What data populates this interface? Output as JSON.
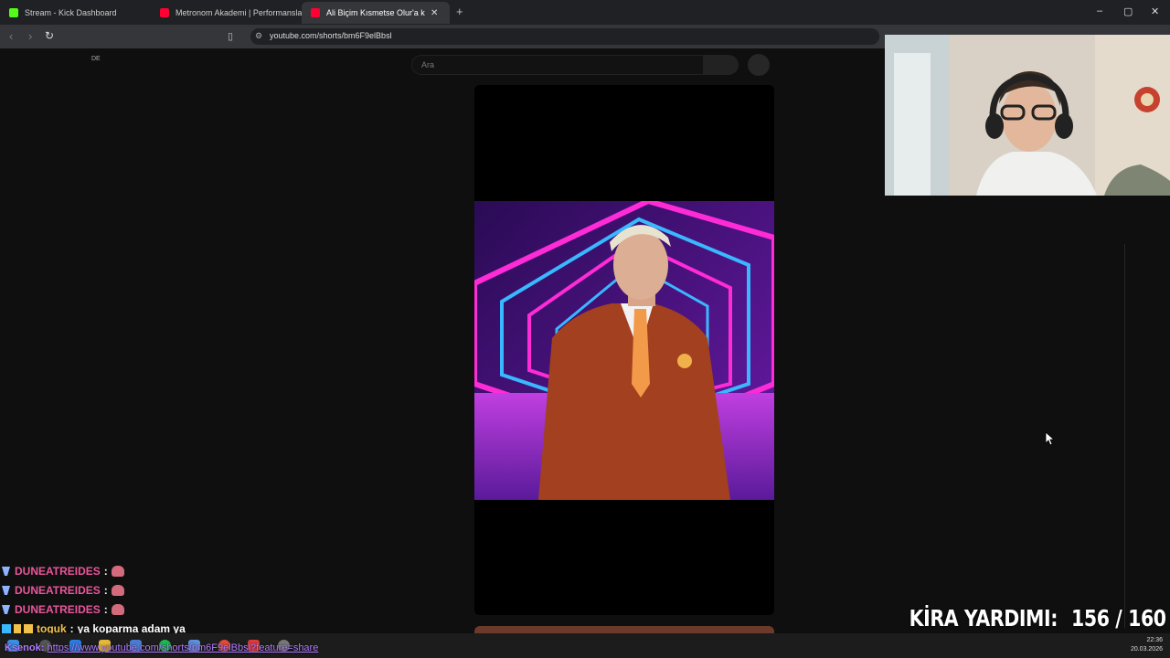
{
  "browser": {
    "tabs": [
      {
        "label": "Stream - Kick Dashboard",
        "color": "#53fc18"
      },
      {
        "label": "Metronom Akademi | Performanslar",
        "color": "#ff0033"
      },
      {
        "label": "Ali Biçim Kısmetse Olur'a katı",
        "color": "#ff0033",
        "active": true
      }
    ],
    "new_tab": "+",
    "url": "youtube.com/shorts/bm6F9elBbsl",
    "win": {
      "min": "–",
      "max": "▢",
      "close": "✕"
    }
  },
  "page": {
    "lang_marker": "DE",
    "search_placeholder": "Ara"
  },
  "chat": [
    {
      "user": "DUNEATREIDES",
      "sep": ":",
      "message": ""
    },
    {
      "user": "DUNEATREIDES",
      "sep": ":",
      "message": ""
    },
    {
      "user": "DUNEATREIDES",
      "sep": ":",
      "message": ""
    },
    {
      "user": "toguk",
      "sep": ":",
      "message": "ya koparma adam ya"
    },
    {
      "user": "Ksenok",
      "sep": ":",
      "message": "https://www.youtube.com/shorts/bm6F9elBbsl?feature=share"
    }
  ],
  "overlay": {
    "label": "KİRA YARDIMI:",
    "value": "156 / 160"
  },
  "taskbar": {
    "time": "22:36",
    "date": "20.03.2026"
  },
  "colors": {
    "kick": "#53fc18",
    "youtube": "#ff0033",
    "chat_user": "#e9569a",
    "link": "#b07cff"
  }
}
